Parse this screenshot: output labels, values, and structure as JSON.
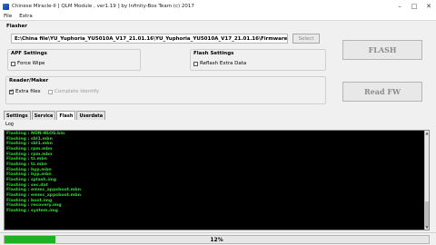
{
  "window": {
    "title": "Chinese Miracle-II [ QLM Module , ver1.19 ] by Infinity-Box Team (c) 2017"
  },
  "menu": {
    "items": [
      "File",
      "Extra"
    ]
  },
  "flasher": {
    "label": "Flasher",
    "path": "E:\\China file\\YU_Yuphoria_YU5010A_V17_21.01.16\\YU_Yuphoria_YU5010A_V17_21.01.16\\Firmware\\",
    "select_label": "Select"
  },
  "apf_settings": {
    "title": "APF Settings",
    "force_wipe": {
      "label": "Force Wipe",
      "checked": false
    }
  },
  "flash_settings": {
    "title": "Flash Settings",
    "reflash_extra": {
      "label": "Reflash Extra Data",
      "checked": false
    }
  },
  "reader_maker": {
    "title": "Reader/Maker",
    "extra_files": {
      "label": "Extra files",
      "checked": true
    },
    "complete_identify": {
      "label": "Complete Identify",
      "checked": false
    }
  },
  "buttons": {
    "flash": "FLASH",
    "read_fw": "Read FW"
  },
  "tabs": [
    {
      "label": "Settings",
      "active": false
    },
    {
      "label": "Service",
      "active": false
    },
    {
      "label": "Flash",
      "active": true
    },
    {
      "label": "Userdata",
      "active": false
    }
  ],
  "log": {
    "label": "Log",
    "lines": [
      "Flashing : NON-HLOS.bin",
      "Flashing : sbl1.mbn",
      "Flashing : sbl1.mbn",
      "Flashing : rpm.mbn",
      "Flashing : rpm.mbn",
      "Flashing : tz.mbn",
      "Flashing : tz.mbn",
      "Flashing : hyp.mbn",
      "Flashing : hyp.mbn",
      "Flashing : splash.img",
      "Flashing : sec.dat",
      "Flashing : emmc_appsboot.mbn",
      "Flashing : emmc_appsboot.mbn",
      "Flashing : boot.img",
      "Flashing : recovery.img",
      "Flashing : system.img"
    ]
  },
  "progress": {
    "percent": 12,
    "text": "12%"
  },
  "colors": {
    "log_text": "#35d435",
    "progress_fill": "#1fb025"
  }
}
